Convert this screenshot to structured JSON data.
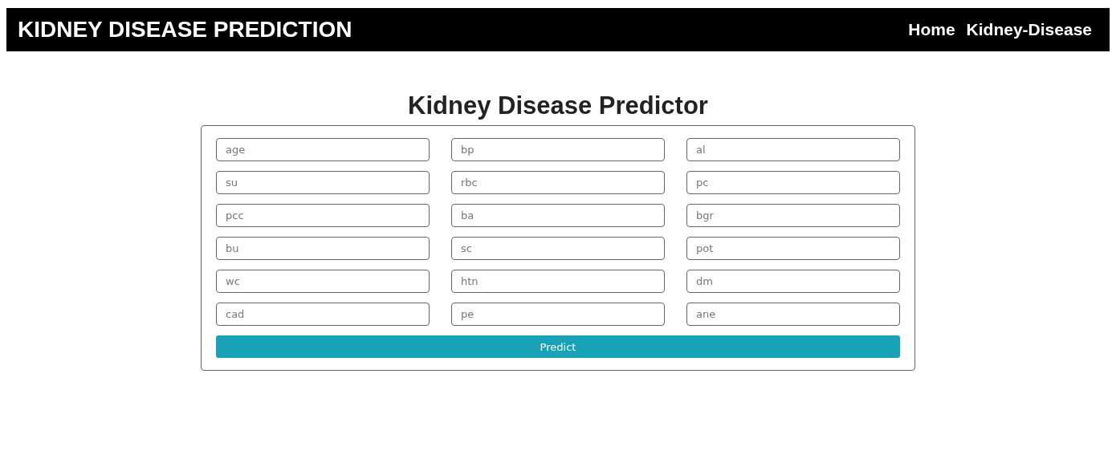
{
  "navbar": {
    "brand": "KIDNEY DISEASE PREDICTION",
    "links": [
      "Home",
      "Kidney-Disease"
    ]
  },
  "form": {
    "title": "Kidney Disease Predictor",
    "fields": [
      {
        "placeholder": "age"
      },
      {
        "placeholder": "bp"
      },
      {
        "placeholder": "al"
      },
      {
        "placeholder": "su"
      },
      {
        "placeholder": "rbc"
      },
      {
        "placeholder": "pc"
      },
      {
        "placeholder": "pcc"
      },
      {
        "placeholder": "ba"
      },
      {
        "placeholder": "bgr"
      },
      {
        "placeholder": "bu"
      },
      {
        "placeholder": "sc"
      },
      {
        "placeholder": "pot"
      },
      {
        "placeholder": "wc"
      },
      {
        "placeholder": "htn"
      },
      {
        "placeholder": "dm"
      },
      {
        "placeholder": "cad"
      },
      {
        "placeholder": "pe"
      },
      {
        "placeholder": "ane"
      }
    ],
    "submit": "Predict"
  }
}
